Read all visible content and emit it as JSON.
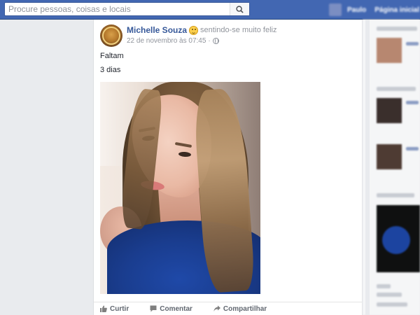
{
  "topbar": {
    "search_placeholder": "Procure pessoas, coisas e locais",
    "profile_label": "Paulo",
    "home_label": "Página inicial"
  },
  "post": {
    "author": "Michelle Souza",
    "feeling": "sentindo-se muito feliz",
    "feeling_icon": "smiley-icon",
    "date": "22 de novembro às 07:45",
    "privacy_icon": "globe-icon",
    "text_lines": [
      "Faltam",
      "3 dias"
    ],
    "actions": {
      "like": "Curtir",
      "comment": "Comentar",
      "share": "Compartilhar"
    }
  },
  "colors": {
    "topbar": "#4267b2",
    "link": "#365899",
    "muted": "#90949c",
    "background": "#e9ebee"
  }
}
